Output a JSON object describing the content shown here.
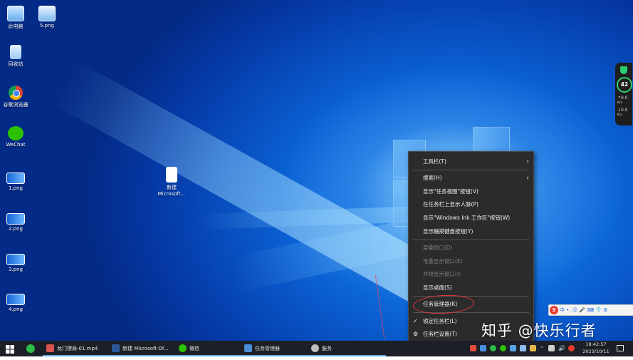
{
  "desktop": {
    "icons": [
      {
        "label": "此电脑",
        "icon": "computer-icon"
      },
      {
        "label": "5.png",
        "icon": "image-file-icon"
      },
      {
        "label": "回收站",
        "icon": "recycle-bin-icon"
      },
      {
        "label": "谷歌浏览器",
        "icon": "chrome-icon"
      },
      {
        "label": "WeChat",
        "icon": "wechat-icon"
      },
      {
        "label": "1.png",
        "icon": "image-file-icon"
      },
      {
        "label": "2.png",
        "icon": "image-file-icon"
      },
      {
        "label": "3.png",
        "icon": "image-file-icon"
      },
      {
        "label": "4.png",
        "icon": "image-file-icon"
      },
      {
        "label": "新建",
        "label2": "Microsoft...",
        "icon": "document-icon"
      }
    ]
  },
  "context_menu": {
    "items": [
      {
        "label": "工具栏(T)",
        "submenu": true,
        "enabled": true
      },
      {
        "label": "搜索(H)",
        "submenu": true,
        "enabled": true
      },
      {
        "label": "显示\"任务视图\"按钮(V)",
        "enabled": true
      },
      {
        "label": "在任务栏上显示人脉(P)",
        "enabled": true
      },
      {
        "label": "显示\"Windows Ink 工作区\"按钮(W)",
        "enabled": true
      },
      {
        "label": "显示触摸键盘按钮(Y)",
        "enabled": true
      },
      {
        "label": "层叠窗口(D)",
        "enabled": false
      },
      {
        "label": "堆叠显示窗口(E)",
        "enabled": false
      },
      {
        "label": "并排显示窗口(I)",
        "enabled": false
      },
      {
        "label": "显示桌面(S)",
        "enabled": true
      },
      {
        "label": "任务管理器(K)",
        "enabled": true,
        "highlighted": true
      },
      {
        "label": "锁定任务栏(L)",
        "checked": true,
        "enabled": true
      },
      {
        "label": "任务栏设置(T)",
        "icon": "gear-icon",
        "enabled": true
      }
    ]
  },
  "widget": {
    "score": "42",
    "upload": {
      "value": "0.0",
      "unit": "K/s"
    },
    "download": {
      "value": "0.0",
      "unit": "K/s"
    }
  },
  "ime_bar": {
    "logo": "S",
    "mode": "中",
    "symbols": "•, ☺ 🎤 ⌨ 👕 ⊞"
  },
  "watermark": "知乎 @快乐行者",
  "taskbar": {
    "items": [
      {
        "label": "龙门镖局-01.mp4",
        "icon": "video-icon",
        "color": "#d9534f"
      },
      {
        "label": "新建 Microsoft Of...",
        "icon": "word-icon",
        "color": "#2b5797"
      },
      {
        "label": "微信",
        "icon": "wechat-icon",
        "color": "#2dc100"
      },
      {
        "label": "任务管理器",
        "icon": "task-manager-icon",
        "color": "#4a90d9"
      },
      {
        "label": "服务",
        "icon": "services-icon",
        "color": "#bfbfbf"
      }
    ],
    "time": "18:42:57",
    "date": "2023/10/11"
  }
}
